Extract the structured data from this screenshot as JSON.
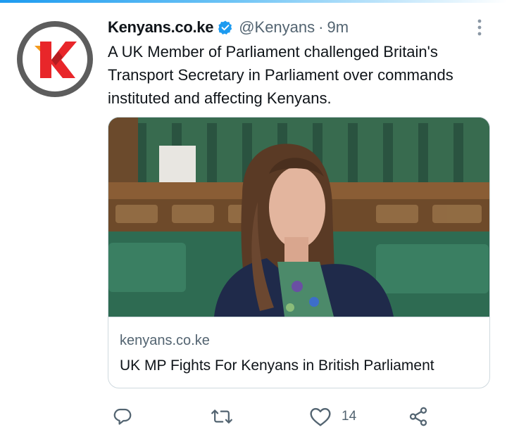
{
  "tweet": {
    "display_name": "Kenyans.co.ke",
    "handle": "@Kenyans",
    "separator": "·",
    "timestamp": "9m",
    "text": "A UK Member of Parliament challenged Britain's Transport Secretary in Parliament over commands instituted and affecting Kenyans.",
    "avatar_icon": "kenyans-k-logo",
    "verified_icon": "verified-badge-icon",
    "more_icon": "more-options-icon"
  },
  "card": {
    "image_description_icon": "news-photo",
    "domain": "kenyans.co.ke",
    "title": "UK MP Fights For Kenyans in British Parliament"
  },
  "actions": {
    "reply_icon": "reply-icon",
    "retweet_icon": "retweet-icon",
    "like_icon": "heart-icon",
    "like_count": "14",
    "share_icon": "share-icon"
  },
  "colors": {
    "accent": "#1d9bf0",
    "text": "#0f1419",
    "secondary_text": "#536471",
    "border": "#cfd9de",
    "logo_red": "#e8262a",
    "logo_orange": "#f39a1e"
  }
}
